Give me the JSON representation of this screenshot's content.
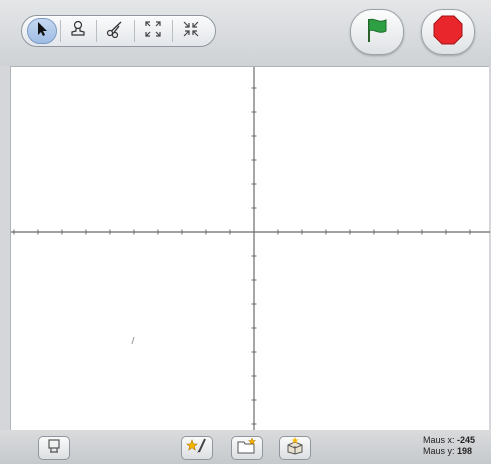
{
  "toolbar": {
    "tools": [
      {
        "name": "arrow-icon",
        "selected": true
      },
      {
        "name": "stamp-icon",
        "selected": false
      },
      {
        "name": "scissors-icon",
        "selected": false
      },
      {
        "name": "grow-icon",
        "selected": false
      },
      {
        "name": "shrink-icon",
        "selected": false
      }
    ],
    "green_flag_icon": "green-flag-icon",
    "stop_icon": "stop-icon",
    "flag_color": "#2ea043",
    "stop_color": "#e8262b"
  },
  "stage": {
    "axis_color": "#6b6b6b",
    "background": "#ffffff"
  },
  "mouse": {
    "x_label": "Maus x:",
    "x_value": "-245",
    "y_label": "Maus y:",
    "y_value": "198"
  }
}
